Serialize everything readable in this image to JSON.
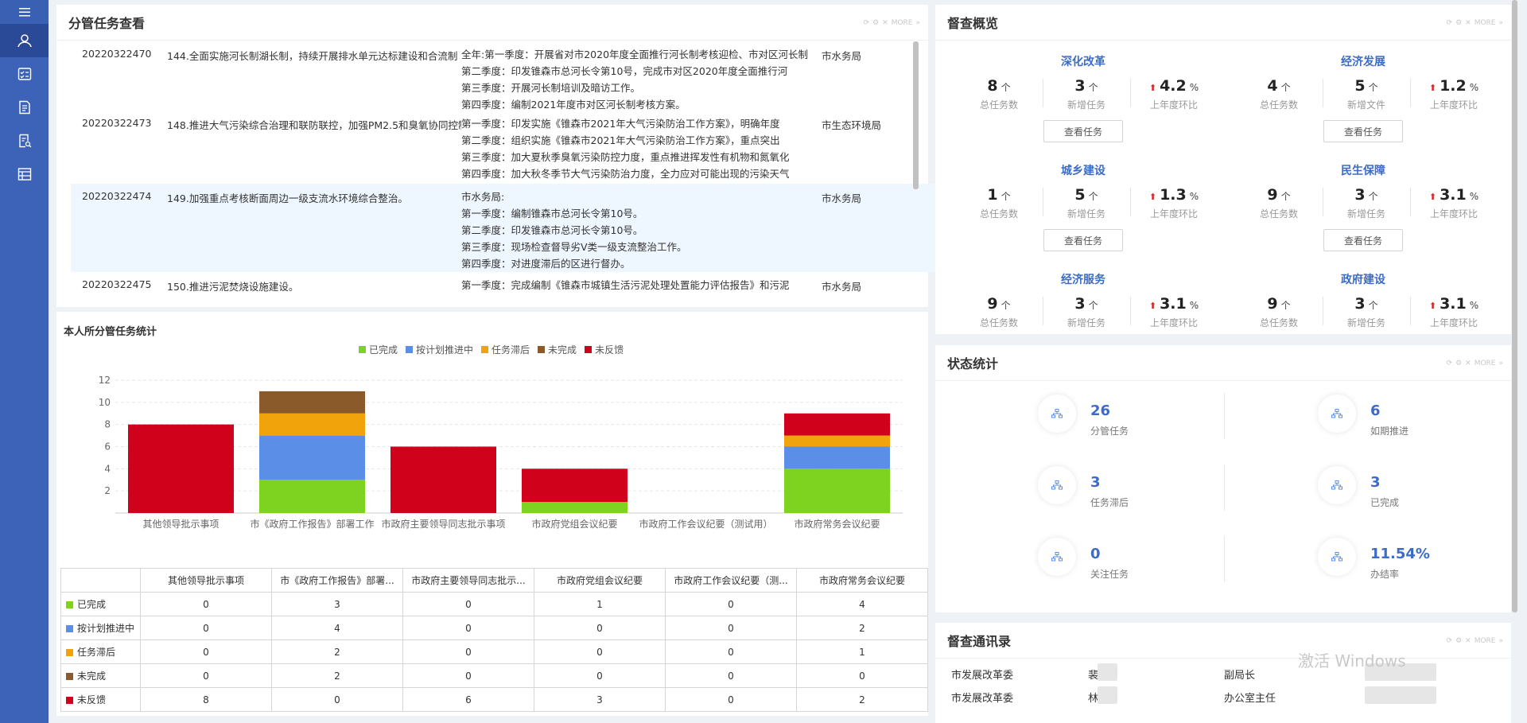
{
  "sidebar": {
    "items": [
      {
        "icon": "user-icon",
        "active": true
      },
      {
        "icon": "task-list-icon"
      },
      {
        "icon": "document-icon"
      },
      {
        "icon": "document-search-icon"
      },
      {
        "icon": "table-icon"
      }
    ]
  },
  "task_panel": {
    "title": "分管任务查看",
    "more": "MORE",
    "tasks": [
      {
        "id": "20220322470",
        "desc": "144.全面实施河长制湖长制，持续开展排水单元达标建设和合流制",
        "plan": [
          "全年:第一季度：开展省对市2020年度全面推行河长制考核迎检、市对区河长制",
          "第二季度：印发锥森市总河长令第10号，完成市对区2020年度全面推行河",
          "第三季度：开展河长制培训及暗访工作。",
          "第四季度：编制2021年度市对区河长制考核方案。"
        ],
        "dept": "市水务局"
      },
      {
        "id": "20220322473",
        "desc": "148.推进大气污染综合治理和联防联控，加强PM2.5和臭氧协同控制",
        "plan": [
          "第一季度：印发实施《锥森市2021年大气污染防治工作方案》，明确年度",
          "第二季度：组织实施《锥森市2021年大气污染防治工作方案》，重点突出",
          "第三季度：加大夏秋季臭氧污染防控力度，重点推进挥发性有机物和氮氧化",
          "第四季度：加大秋冬季节大气污染防治力度，全力应对可能出现的污染天气"
        ],
        "dept": "市生态环境局"
      },
      {
        "id": "20220322474",
        "desc": "149.加强重点考核断面周边一级支流水环境综合整治。",
        "plan": [
          "市水务局:",
          "第一季度：编制锥森市总河长令第10号。",
          "第二季度：印发锥森市总河长令第10号。",
          "第三季度：现场检查督导劣Ⅴ类一级支流整治工作。",
          "第四季度：对进度滞后的区进行督办。"
        ],
        "dept": "市水务局"
      },
      {
        "id": "20220322475",
        "desc": "150.推进污泥焚烧设施建设。",
        "plan": [
          "第一季度：完成编制《锥森市城镇生活污泥处理处置能力评估报告》和污泥"
        ],
        "dept": "市水务局"
      }
    ]
  },
  "chart_panel": {
    "title": "本人所分管任务统计",
    "row_header": "",
    "status_colors": [
      "#7ed321",
      "#5b8ee6",
      "#f0a30a",
      "#8b5a2b",
      "#d0021b"
    ]
  },
  "chart_data": {
    "type": "bar",
    "stacked": true,
    "categories": [
      "其他领导批示事项",
      "市《政府工作报告》部署工作",
      "市政府主要领导同志批示事项",
      "市政府党组会议纪要",
      "市政府工作会议纪要（测试用）",
      "市政府常务会议纪要"
    ],
    "table_headers": [
      "其他领导批示事项",
      "市《政府工作报告》部署...",
      "市政府主要领导同志批示...",
      "市政府党组会议纪要",
      "市政府工作会议纪要（测...",
      "市政府常务会议纪要"
    ],
    "series": [
      {
        "name": "已完成",
        "values": [
          0,
          3,
          0,
          1,
          0,
          4
        ],
        "color": "#7ed321"
      },
      {
        "name": "按计划推进中",
        "values": [
          0,
          4,
          0,
          0,
          0,
          2
        ],
        "color": "#5b8ee6"
      },
      {
        "name": "任务滞后",
        "values": [
          0,
          2,
          0,
          0,
          0,
          1
        ],
        "color": "#f0a30a"
      },
      {
        "name": "未完成",
        "values": [
          0,
          2,
          0,
          0,
          0,
          0
        ],
        "color": "#8b5a2b"
      },
      {
        "name": "未反馈",
        "values": [
          8,
          0,
          6,
          3,
          0,
          2
        ],
        "color": "#d0021b"
      }
    ],
    "ylim": [
      0,
      12
    ],
    "yticks": [
      "2",
      "4",
      "6",
      "8",
      "10",
      "12"
    ],
    "grid": true,
    "legend": "top-center"
  },
  "overview": {
    "title": "督查概览",
    "view_button": "查看任务",
    "labels": {
      "total": "总任务数",
      "new_task": "新增任务",
      "new_doc": "新增文件",
      "yoy": "上年度环比"
    },
    "unit_count": "个",
    "unit_pct": "%",
    "categories": [
      {
        "name": "深化改革",
        "total": "8",
        "new": "3",
        "new_label": "新增任务",
        "yoy": "4.2",
        "button": true
      },
      {
        "name": "经济发展",
        "total": "4",
        "new": "5",
        "new_label": "新增文件",
        "yoy": "1.2",
        "button": true
      },
      {
        "name": "城乡建设",
        "total": "1",
        "new": "5",
        "new_label": "新增任务",
        "yoy": "1.3",
        "button": true
      },
      {
        "name": "民生保障",
        "total": "9",
        "new": "3",
        "new_label": "新增任务",
        "yoy": "3.1",
        "button": true
      },
      {
        "name": "经济服务",
        "total": "9",
        "new": "3",
        "new_label": "新增任务",
        "yoy": "3.1",
        "button": false
      },
      {
        "name": "政府建设",
        "total": "9",
        "new": "3",
        "new_label": "新增任务",
        "yoy": "3.1",
        "button": false
      }
    ]
  },
  "status": {
    "title": "状态统计",
    "items": [
      {
        "value": "26",
        "label": "分管任务"
      },
      {
        "value": "6",
        "label": "如期推进"
      },
      {
        "value": "3",
        "label": "任务滞后"
      },
      {
        "value": "3",
        "label": "已完成"
      },
      {
        "value": "0",
        "label": "关注任务"
      },
      {
        "value": "11.54%",
        "label": "办结率"
      }
    ]
  },
  "directory": {
    "title": "督查通讯录",
    "rows": [
      {
        "dept": "市发展改革委",
        "name": "裴",
        "title": "副局长"
      },
      {
        "dept": "市发展改革委",
        "name": "林",
        "title": "办公室主任"
      }
    ]
  },
  "watermark": "激活 Windows"
}
